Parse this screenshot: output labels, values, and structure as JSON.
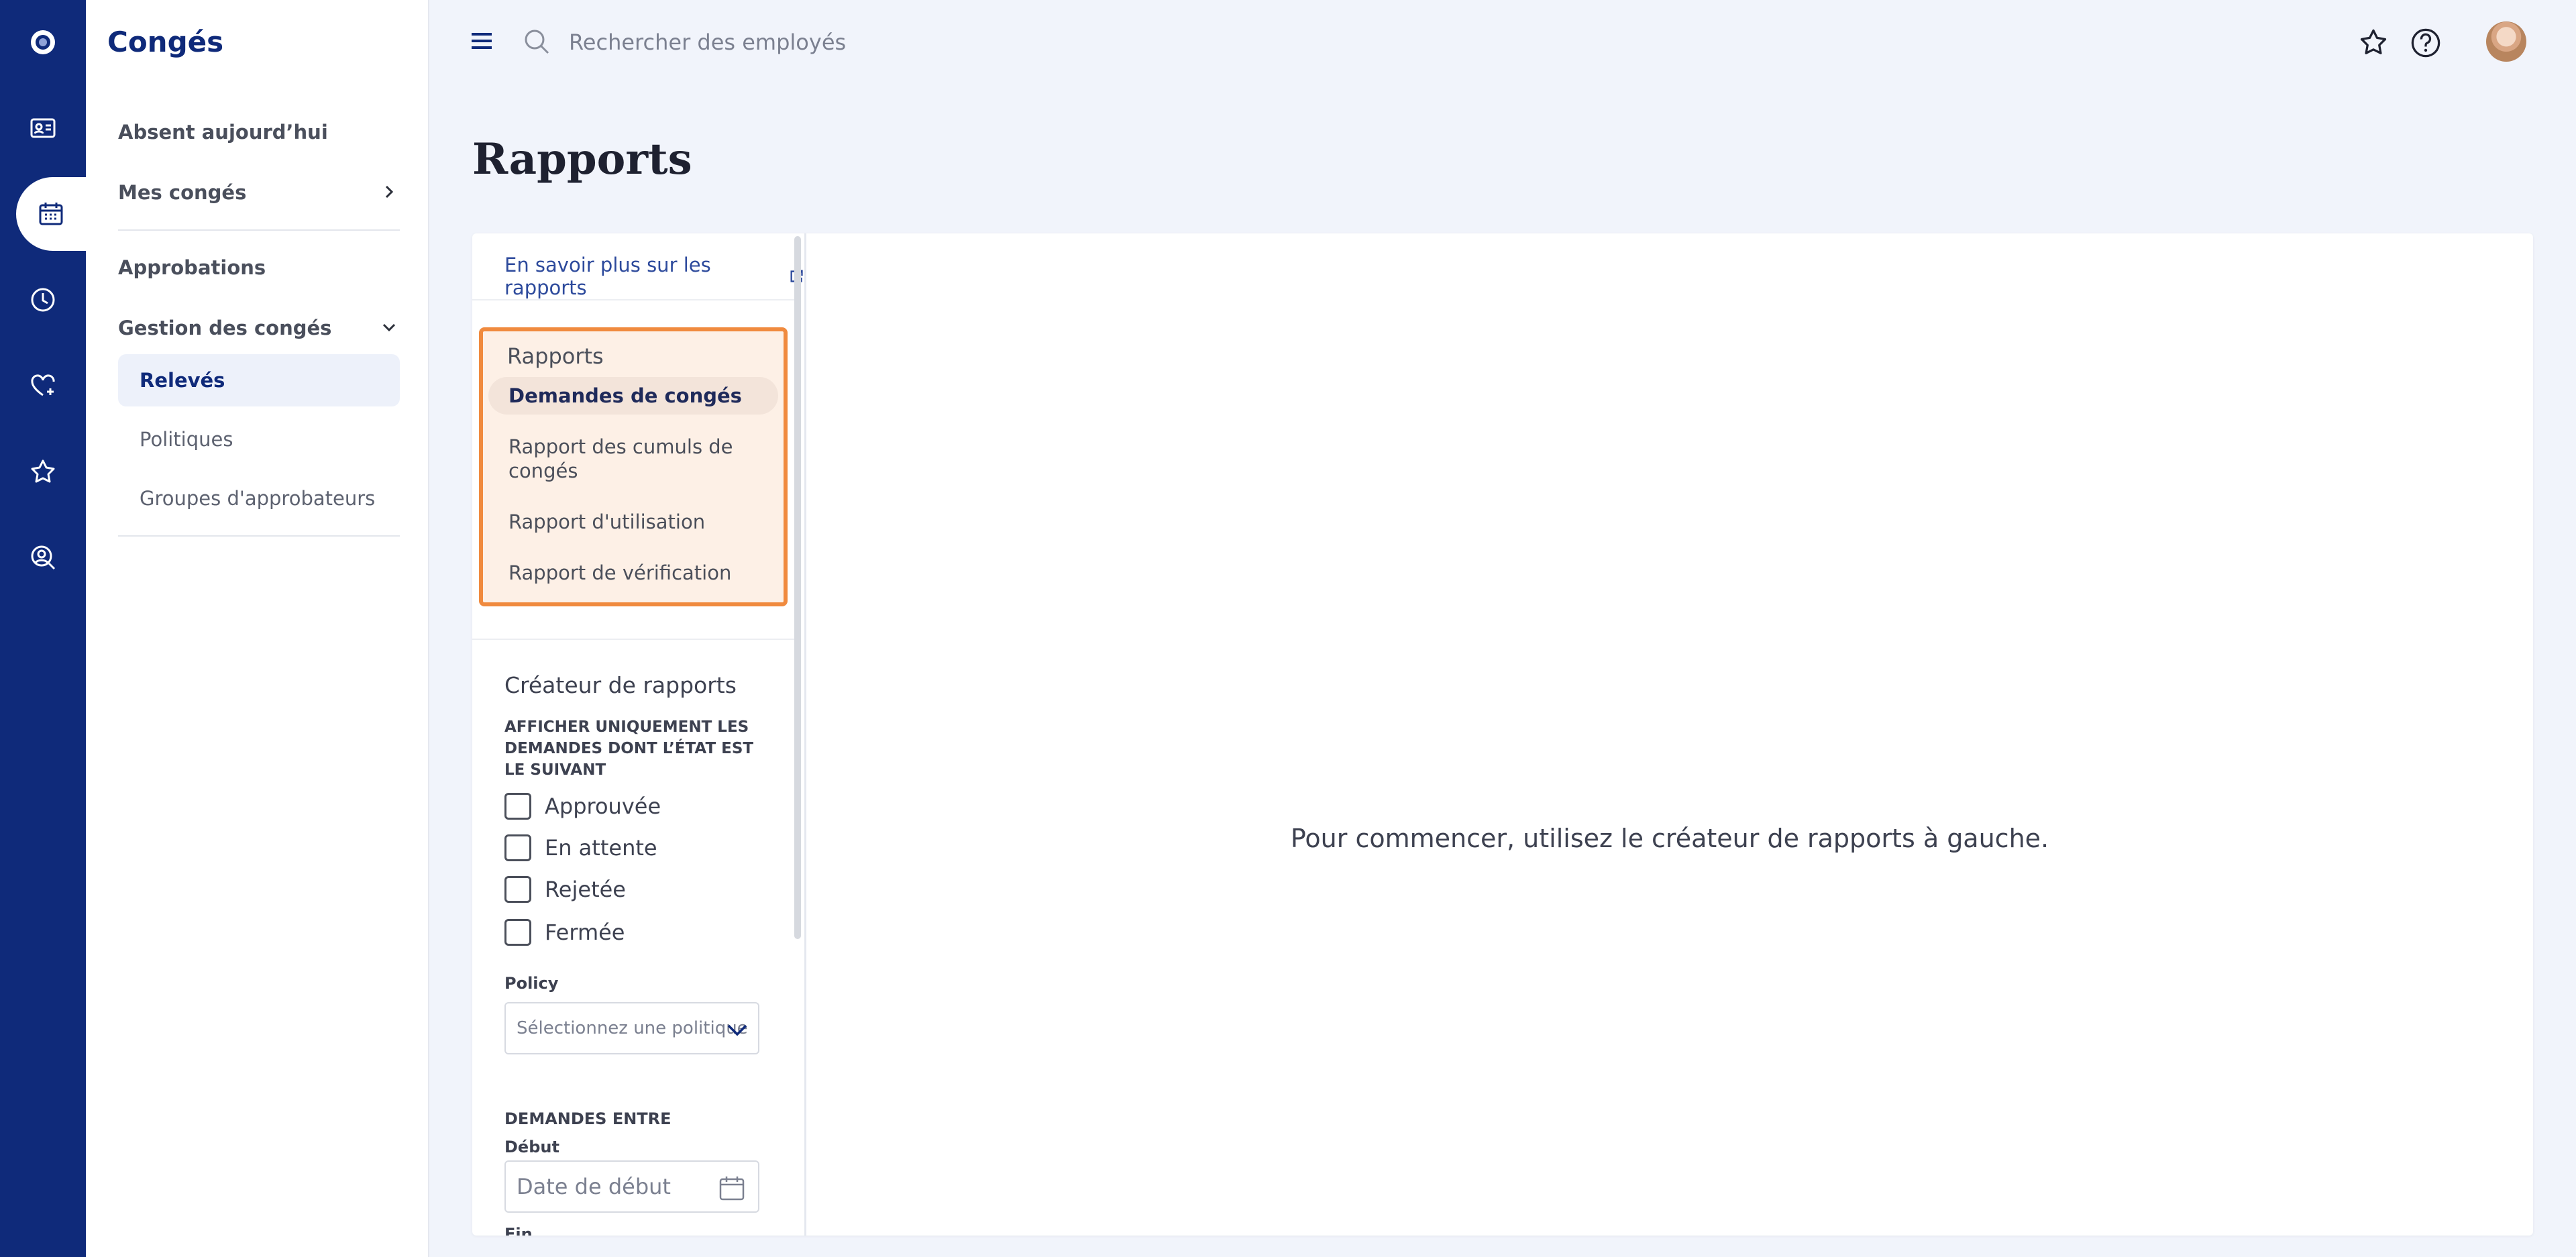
{
  "app": {
    "title": "Congés"
  },
  "rail": {
    "items": [
      {
        "name": "logo-icon"
      },
      {
        "name": "id-card-icon"
      },
      {
        "name": "calendar-icon",
        "active": true
      },
      {
        "name": "clock-icon"
      },
      {
        "name": "heart-plus-icon"
      },
      {
        "name": "star-icon"
      },
      {
        "name": "person-search-icon"
      }
    ]
  },
  "sidebar": {
    "absent_today": "Absent aujourd’hui",
    "my_leave": "Mes congés",
    "approvals": "Approbations",
    "leave_management": "Gestion des congés",
    "sub_items": [
      "Relevés",
      "Politiques",
      "Groupes d'approbateurs"
    ]
  },
  "topbar": {
    "search_placeholder": "Rechercher des employés"
  },
  "page": {
    "title": "Rapports"
  },
  "report_panel": {
    "learn_more": "En savoir plus sur les rapports",
    "reports_heading": "Rapports",
    "reports": [
      "Demandes de congés",
      "Rapport des cumuls de congés",
      "Rapport d'utilisation",
      "Rapport de vérification"
    ],
    "builder_heading": "Créateur de rapports",
    "status_filter_label": "AFFICHER UNIQUEMENT LES DEMANDES DONT L’ÉTAT EST LE SUIVANT",
    "statuses": [
      "Approuvée",
      "En attente",
      "Rejetée",
      "Fermée"
    ],
    "policy_label": "Policy",
    "policy_placeholder": "Sélectionnez une politique",
    "date_range_label": "DEMANDES ENTRE",
    "start_label": "Début",
    "start_placeholder": "Date de début",
    "end_label": "Fin",
    "empty_message": "Pour commencer, utilisez le créateur de rapports à gauche."
  },
  "colors": {
    "brand_navy": "#0f2a7a",
    "highlight_orange": "#f08a3e",
    "highlight_bg": "#fdf0e6",
    "page_bg": "#f1f4fb"
  }
}
